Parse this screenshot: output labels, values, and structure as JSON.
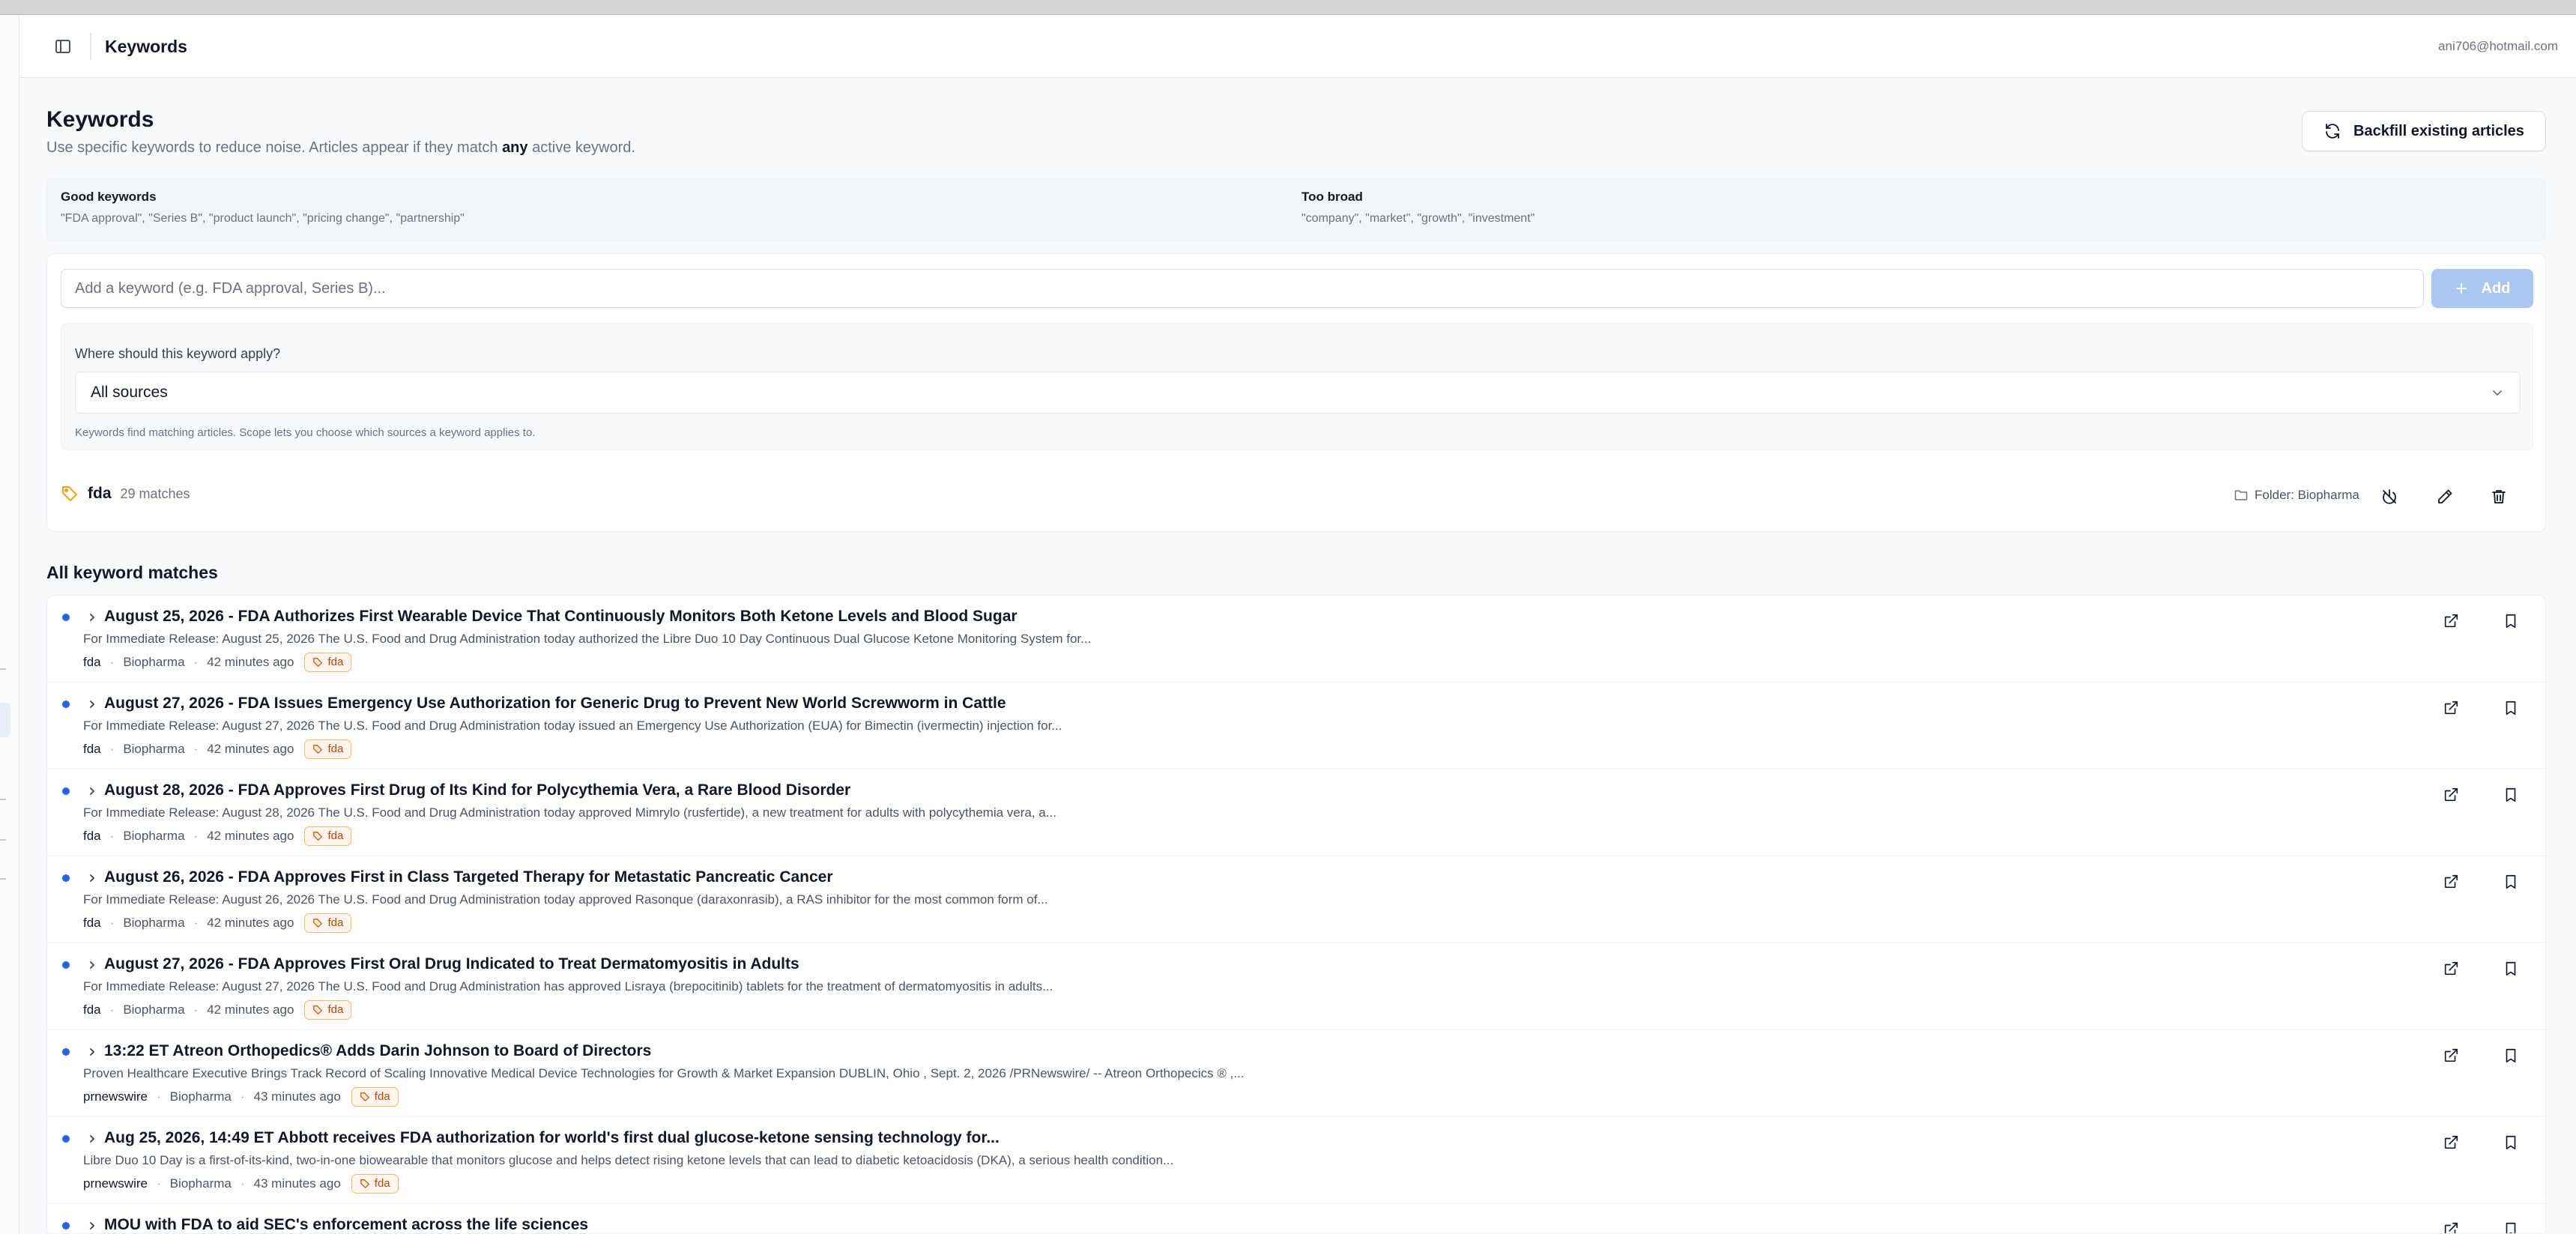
{
  "header": {
    "title": "Keywords",
    "user_email": "ani706@hotmail.com"
  },
  "page": {
    "title": "Keywords",
    "subtitle_before": "Use specific keywords to reduce noise. Articles appear if they match ",
    "subtitle_emphasis": "any",
    "subtitle_after": " active keyword.",
    "backfill_label": "Backfill existing articles"
  },
  "tips": {
    "good_title": "Good keywords",
    "good_examples": "\"FDA approval\", \"Series B\", \"product launch\", \"pricing change\", \"partnership\"",
    "broad_title": "Too broad",
    "broad_examples": "\"company\", \"market\", \"growth\", \"investment\""
  },
  "add_keyword": {
    "placeholder": "Add a keyword (e.g. FDA approval, Series B)...",
    "value": "",
    "add_label": "Add",
    "scope_question": "Where should this keyword apply?",
    "scope_selected": "All sources",
    "scope_help": "Keywords find matching articles. Scope lets you choose which sources a keyword applies to."
  },
  "keywords": [
    {
      "name": "fda",
      "matches": "29 matches",
      "folder": "Folder: Biopharma"
    }
  ],
  "matches": {
    "title": "All keyword matches",
    "items": [
      {
        "title": "August 25, 2026 - FDA Authorizes First Wearable Device That Continuously Monitors Both Ketone Levels and Blood Sugar",
        "snippet": "For Immediate Release: August 25, 2026 The U.S. Food and Drug Administration today authorized the Libre Duo 10 Day Continuous Dual Glucose Ketone Monitoring System for...",
        "source": "fda",
        "folder": "Biopharma",
        "time": "42 minutes ago",
        "tag": "fda"
      },
      {
        "title": "August 27, 2026 - FDA Issues Emergency Use Authorization for Generic Drug to Prevent New World Screwworm in Cattle",
        "snippet": "For Immediate Release: August 27, 2026 The U.S. Food and Drug Administration today issued an Emergency Use Authorization (EUA) for Bimectin (ivermectin) injection for...",
        "source": "fda",
        "folder": "Biopharma",
        "time": "42 minutes ago",
        "tag": "fda"
      },
      {
        "title": "August 28, 2026 - FDA Approves First Drug of Its Kind for Polycythemia Vera, a Rare Blood Disorder",
        "snippet": "For Immediate Release: August 28, 2026 The U.S. Food and Drug Administration today approved Mimrylo (rusfertide), a new treatment for adults with polycythemia vera, a...",
        "source": "fda",
        "folder": "Biopharma",
        "time": "42 minutes ago",
        "tag": "fda"
      },
      {
        "title": "August 26, 2026 - FDA Approves First in Class Targeted Therapy for Metastatic Pancreatic Cancer",
        "snippet": "For Immediate Release: August 26, 2026 The U.S. Food and Drug Administration today approved Rasonque (daraxonrasib), a RAS inhibitor for the most common form of...",
        "source": "fda",
        "folder": "Biopharma",
        "time": "42 minutes ago",
        "tag": "fda"
      },
      {
        "title": "August 27, 2026 - FDA Approves First Oral Drug Indicated to Treat Dermatomyositis in Adults",
        "snippet": "For Immediate Release: August 27, 2026 The U.S. Food and Drug Administration has approved Lisraya (brepocitinib) tablets for the treatment of dermatomyositis in adults...",
        "source": "fda",
        "folder": "Biopharma",
        "time": "42 minutes ago",
        "tag": "fda"
      },
      {
        "title": "13:22 ET Atreon Orthopedics® Adds Darin Johnson to Board of Directors",
        "snippet": "Proven Healthcare Executive Brings Track Record of Scaling Innovative Medical Device Technologies for Growth & Market Expansion DUBLIN, Ohio , Sept. 2, 2026 /PRNewswire/ -- Atreon Orthopecics ® ,...",
        "source": "prnewswire",
        "folder": "Biopharma",
        "time": "43 minutes ago",
        "tag": "fda"
      },
      {
        "title": "Aug 25, 2026, 14:49 ET Abbott receives FDA authorization for world's first dual glucose-ketone sensing technology for...",
        "snippet": "Libre Duo 10 Day is a first-of-its-kind, two-in-one biowearable that monitors glucose and helps detect rising ketone levels that can lead to diabetic ketoacidosis (DKA), a serious health condition...",
        "source": "prnewswire",
        "folder": "Biopharma",
        "time": "43 minutes ago",
        "tag": "fda"
      },
      {
        "title": "MOU with FDA to aid SEC's enforcement across the life sciences",
        "snippet": "",
        "source": "",
        "folder": "",
        "time": "",
        "tag": ""
      }
    ]
  }
}
